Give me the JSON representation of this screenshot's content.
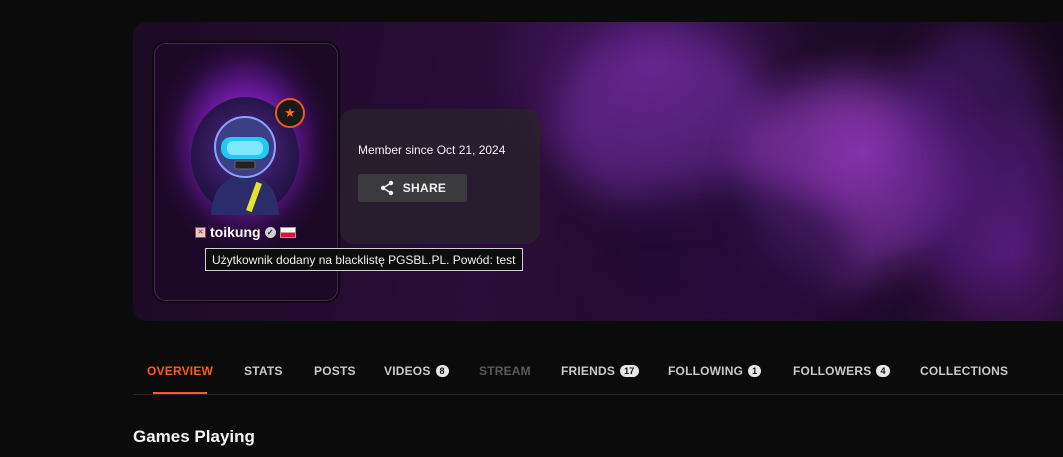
{
  "profile": {
    "username": "toikung",
    "member_since": "Member since Oct 21, 2024",
    "share_label": "SHARE",
    "tooltip": "Użytkownik dodany na blacklistę PGSBL.PL. Powód: test"
  },
  "icons": {
    "blacklist": "blacklist-icon",
    "verified": "verified-icon",
    "flag": "poland-flag-icon",
    "share": "share-icon",
    "rank": "rank-badge-icon"
  },
  "tabs": [
    {
      "label": "OVERVIEW",
      "count": null
    },
    {
      "label": "STATS",
      "count": null
    },
    {
      "label": "POSTS",
      "count": null
    },
    {
      "label": "VIDEOS",
      "count": "8"
    },
    {
      "label": "STREAM",
      "count": null
    },
    {
      "label": "FRIENDS",
      "count": "17"
    },
    {
      "label": "FOLLOWING",
      "count": "1"
    },
    {
      "label": "FOLLOWERS",
      "count": "4"
    },
    {
      "label": "COLLECTIONS",
      "count": null
    }
  ],
  "sections": {
    "games_playing": "Games Playing"
  },
  "colors": {
    "accent": "#ff5a1f",
    "background": "#0b0b0c"
  }
}
